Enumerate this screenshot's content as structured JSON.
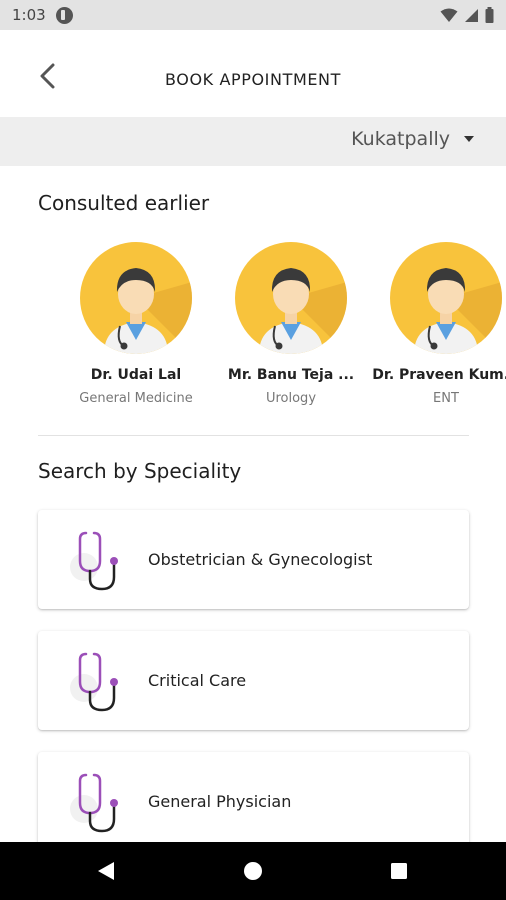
{
  "status_bar": {
    "time": "1:03"
  },
  "header": {
    "title": "BOOK APPOINTMENT"
  },
  "location": {
    "selected": "Kukatpally"
  },
  "consulted": {
    "title": "Consulted earlier",
    "doctors": [
      {
        "name": "Dr. Udai Lal",
        "speciality": "General Medicine"
      },
      {
        "name": "Mr. Banu Teja ...",
        "speciality": "Urology"
      },
      {
        "name": "Dr. Praveen Kum...",
        "speciality": "ENT"
      }
    ]
  },
  "speciality": {
    "title": "Search by Speciality",
    "items": [
      {
        "label": "Obstetrician & Gynecologist"
      },
      {
        "label": "Critical Care"
      },
      {
        "label": "General Physician"
      }
    ]
  },
  "colors": {
    "avatar_bg": "#f8c33c",
    "stethoscope": "#9b4fb8",
    "nav_bar": "#000000"
  }
}
